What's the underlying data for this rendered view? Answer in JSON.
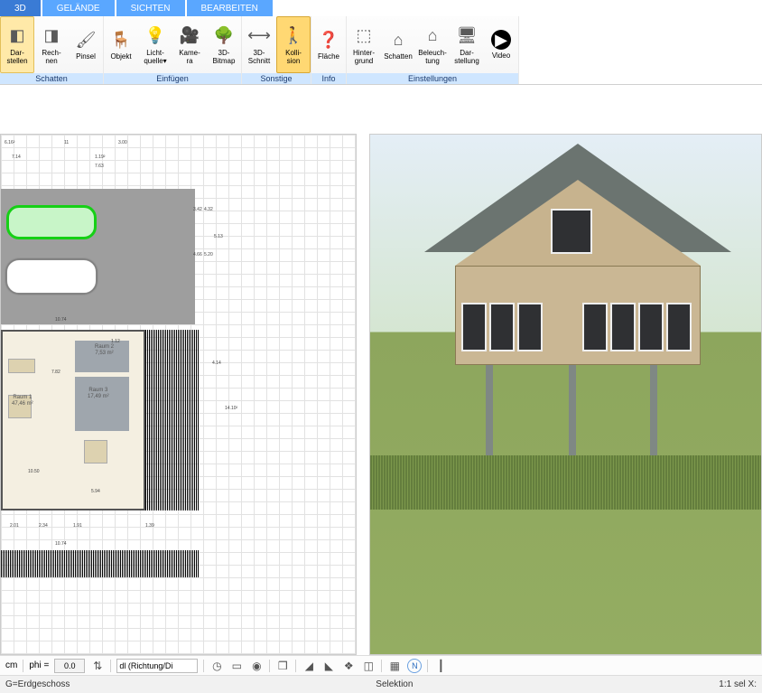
{
  "tabs": {
    "active": "3D",
    "items": [
      "3D",
      "GELÄNDE",
      "SICHTEN",
      "BEARBEITEN"
    ]
  },
  "ribbon": {
    "groups": [
      {
        "label": "Schatten",
        "buttons": [
          {
            "id": "darstellen",
            "line1": "Dar-",
            "line2": "stellen",
            "active": true,
            "icon": "◧"
          },
          {
            "id": "rechnen",
            "line1": "Rech-",
            "line2": "nen",
            "icon": "◨"
          },
          {
            "id": "pinsel",
            "line1": "Pinsel",
            "line2": "",
            "icon": "🖌"
          }
        ]
      },
      {
        "label": "Einfügen",
        "buttons": [
          {
            "id": "objekt",
            "line1": "Objekt",
            "line2": "",
            "icon": "🪑"
          },
          {
            "id": "lichtquelle",
            "line1": "Licht-",
            "line2": "quelle▾",
            "icon": "💡"
          },
          {
            "id": "kamera",
            "line1": "Kame-",
            "line2": "ra",
            "icon": "🎥"
          },
          {
            "id": "3dbitmap",
            "line1": "3D-",
            "line2": "Bitmap",
            "icon": "🌳"
          }
        ]
      },
      {
        "label": "Sonstige",
        "buttons": [
          {
            "id": "3dschnitt",
            "line1": "3D-",
            "line2": "Schnitt",
            "icon": "⟷"
          },
          {
            "id": "kollision",
            "line1": "Kolli-",
            "line2": "sion",
            "active2": true,
            "icon": "🚶"
          }
        ]
      },
      {
        "label": "Info",
        "buttons": [
          {
            "id": "flaeche",
            "line1": "Fläche",
            "line2": "",
            "icon": "❓"
          }
        ]
      },
      {
        "label": "Einstellungen",
        "buttons": [
          {
            "id": "hintergrund",
            "line1": "Hinter-",
            "line2": "grund",
            "icon": "⬚"
          },
          {
            "id": "schatten2",
            "line1": "Schatten",
            "line2": "",
            "icon": "⌂"
          },
          {
            "id": "beleuchtung",
            "line1": "Beleuch-",
            "line2": "tung",
            "icon": "⌂"
          },
          {
            "id": "darstellung",
            "line1": "Dar-",
            "line2": "stellung",
            "icon": "🖥"
          },
          {
            "id": "video",
            "line1": "Video",
            "line2": "",
            "icon": "▶"
          }
        ]
      }
    ]
  },
  "plan": {
    "rooms": [
      {
        "name": "Raum 1",
        "area": "47,46 m²"
      },
      {
        "name": "Raum 2",
        "area": "7,53 m²"
      },
      {
        "name": "Raum 3",
        "area": "17,49 m²"
      }
    ],
    "dims": [
      "6.16²",
      "11",
      "3.00",
      "7.14",
      "1.19²",
      "7.63",
      "3.42",
      "4.66",
      "4.32",
      "5.20",
      "5.13",
      "10.74",
      "7.82",
      "1.12",
      "4.14",
      "14.10²",
      "10.50",
      "5.94",
      "2.01",
      "2.34",
      "1.91",
      "10.74",
      "1.39"
    ]
  },
  "bottom": {
    "unit": "cm",
    "phi_label": "phi =",
    "phi_value": "0.0",
    "mode": "dl (Richtung/Di",
    "icons": [
      "clock",
      "screen",
      "globe",
      "stack",
      "angle1",
      "angle2",
      "layers",
      "cube",
      "grid",
      "north",
      "bar"
    ]
  },
  "status": {
    "left": "G=Erdgeschoss",
    "mid": "Selektion",
    "right": "1:1 sel   X:"
  }
}
